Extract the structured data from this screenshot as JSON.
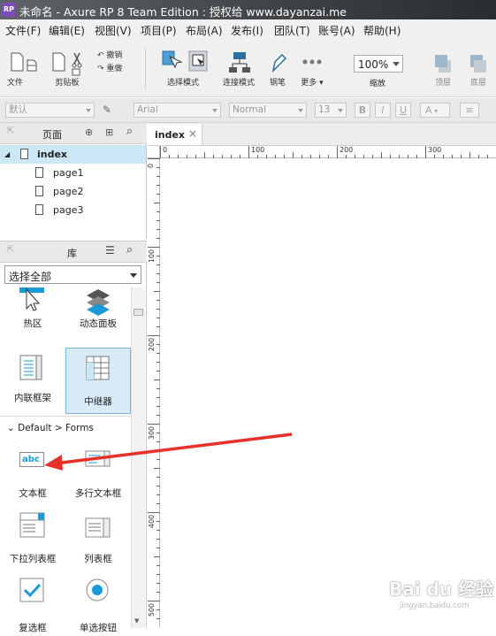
{
  "window": {
    "title": "未命名 - Axure RP 8 Team Edition : 授权给 www.dayanzai.me",
    "app_badge": "RP"
  },
  "menu": [
    "文件(F)",
    "编辑(E)",
    "视图(V)",
    "项目(P)",
    "布局(A)",
    "发布(I)",
    "团队(T)",
    "账号(A)",
    "帮助(H)"
  ],
  "toolbar": {
    "file": "文件",
    "clipboard": "剪贴板",
    "undo": "撤销",
    "redo": "重做",
    "select_mode": "选择模式",
    "connect_mode": "连接模式",
    "pen": "钢笔",
    "more": "更多",
    "zoom_value": "100%",
    "zoom_label": "缩放",
    "top": "顶层",
    "bottom": "底层"
  },
  "format": {
    "style": "默认",
    "font": "Arial",
    "weight": "Normal",
    "size": "13",
    "bold": "B",
    "italic": "I",
    "underline": "U",
    "color": "A"
  },
  "pages": {
    "title": "页面",
    "root": "index",
    "children": [
      "page1",
      "page2",
      "page3"
    ]
  },
  "library": {
    "title": "库",
    "selector": "选择全部",
    "items_top": [
      "热区",
      "动态面板",
      "内联框架",
      "中继器"
    ],
    "section": "Default > Forms",
    "items_forms": [
      "文本框",
      "多行文本框",
      "下拉列表框",
      "列表框",
      "复选框",
      "单选按钮"
    ],
    "textbox_glyph": "abc"
  },
  "editor": {
    "tab": "index",
    "tab_close": "×",
    "h_ticks": [
      "0",
      "100",
      "200",
      "300"
    ],
    "v_ticks": [
      "0",
      "100",
      "200",
      "300",
      "400",
      "500"
    ]
  },
  "watermark": {
    "main": "Bai du 经验",
    "sub": "jingyan.baidu.com"
  },
  "colors": {
    "accent": "#1a9bd7",
    "selected_row": "#cce8f6",
    "arrow": "#e8302a"
  }
}
